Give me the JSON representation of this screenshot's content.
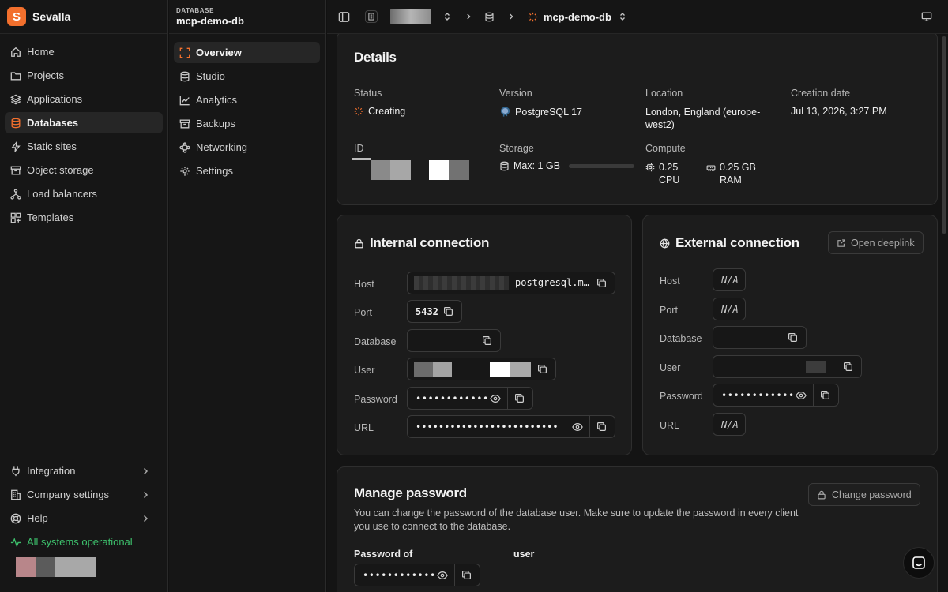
{
  "brand": {
    "name": "Sevalla",
    "logo_letter": "S",
    "accent": "#f3702d"
  },
  "nav": {
    "items": [
      {
        "label": "Home",
        "icon": "home-icon"
      },
      {
        "label": "Projects",
        "icon": "folder-icon"
      },
      {
        "label": "Applications",
        "icon": "layers-icon"
      },
      {
        "label": "Databases",
        "icon": "database-icon",
        "active": true
      },
      {
        "label": "Static sites",
        "icon": "bolt-icon"
      },
      {
        "label": "Object storage",
        "icon": "archive-icon"
      },
      {
        "label": "Load balancers",
        "icon": "network-icon"
      },
      {
        "label": "Templates",
        "icon": "templates-icon"
      }
    ],
    "bottom": [
      {
        "label": "Integration",
        "icon": "plug-icon"
      },
      {
        "label": "Company settings",
        "icon": "building-icon"
      },
      {
        "label": "Help",
        "icon": "lifebuoy-icon"
      }
    ],
    "status": "All systems operational",
    "status_color": "#3dc06c"
  },
  "subnav": {
    "kicker": "DATABASE",
    "title": "mcp-demo-db",
    "items": [
      {
        "label": "Overview",
        "icon": "overview-icon",
        "active": true
      },
      {
        "label": "Studio",
        "icon": "database-icon"
      },
      {
        "label": "Analytics",
        "icon": "chart-icon"
      },
      {
        "label": "Backups",
        "icon": "backup-icon"
      },
      {
        "label": "Networking",
        "icon": "networking-icon"
      },
      {
        "label": "Settings",
        "icon": "gear-icon"
      }
    ]
  },
  "topbar": {
    "db_name": "mcp-demo-db"
  },
  "details": {
    "title": "Details",
    "status_label": "Status",
    "status_value": "Creating",
    "version_label": "Version",
    "version_value": "PostgreSQL 17",
    "location_label": "Location",
    "location_value": "London, England (europe-west2)",
    "creation_label": "Creation date",
    "creation_value": "Jul 13, 2026, 3:27 PM",
    "id_label": "ID",
    "storage_label": "Storage",
    "storage_value": "Max: 1 GB",
    "storage_used": 0,
    "compute_label": "Compute",
    "cpu_value": "0.25 CPU",
    "ram_value": "0.25 GB RAM"
  },
  "internal": {
    "title": "Internal connection",
    "host_label": "Host",
    "host_value": "postgresql.m…",
    "port_label": "Port",
    "port_value": "5432",
    "database_label": "Database",
    "user_label": "User",
    "password_label": "Password",
    "password_value": "••••••••••••",
    "url_label": "URL",
    "url_value": "•••••••••••••••••••••••••…"
  },
  "external": {
    "title": "External connection",
    "open_deeplink": "Open deeplink",
    "host_label": "Host",
    "host_value": "N/A",
    "port_label": "Port",
    "port_value": "N/A",
    "database_label": "Database",
    "user_label": "User",
    "password_label": "Password",
    "password_value": "••••••••••••",
    "url_label": "URL",
    "url_value": "N/A"
  },
  "manage": {
    "title": "Manage password",
    "description": "You can change the password of the database user. Make sure to update the password in every client you use to connect to the database.",
    "change_button": "Change password",
    "password_of": "Password of",
    "user_suffix": "user",
    "password_value": "••••••••••••"
  }
}
